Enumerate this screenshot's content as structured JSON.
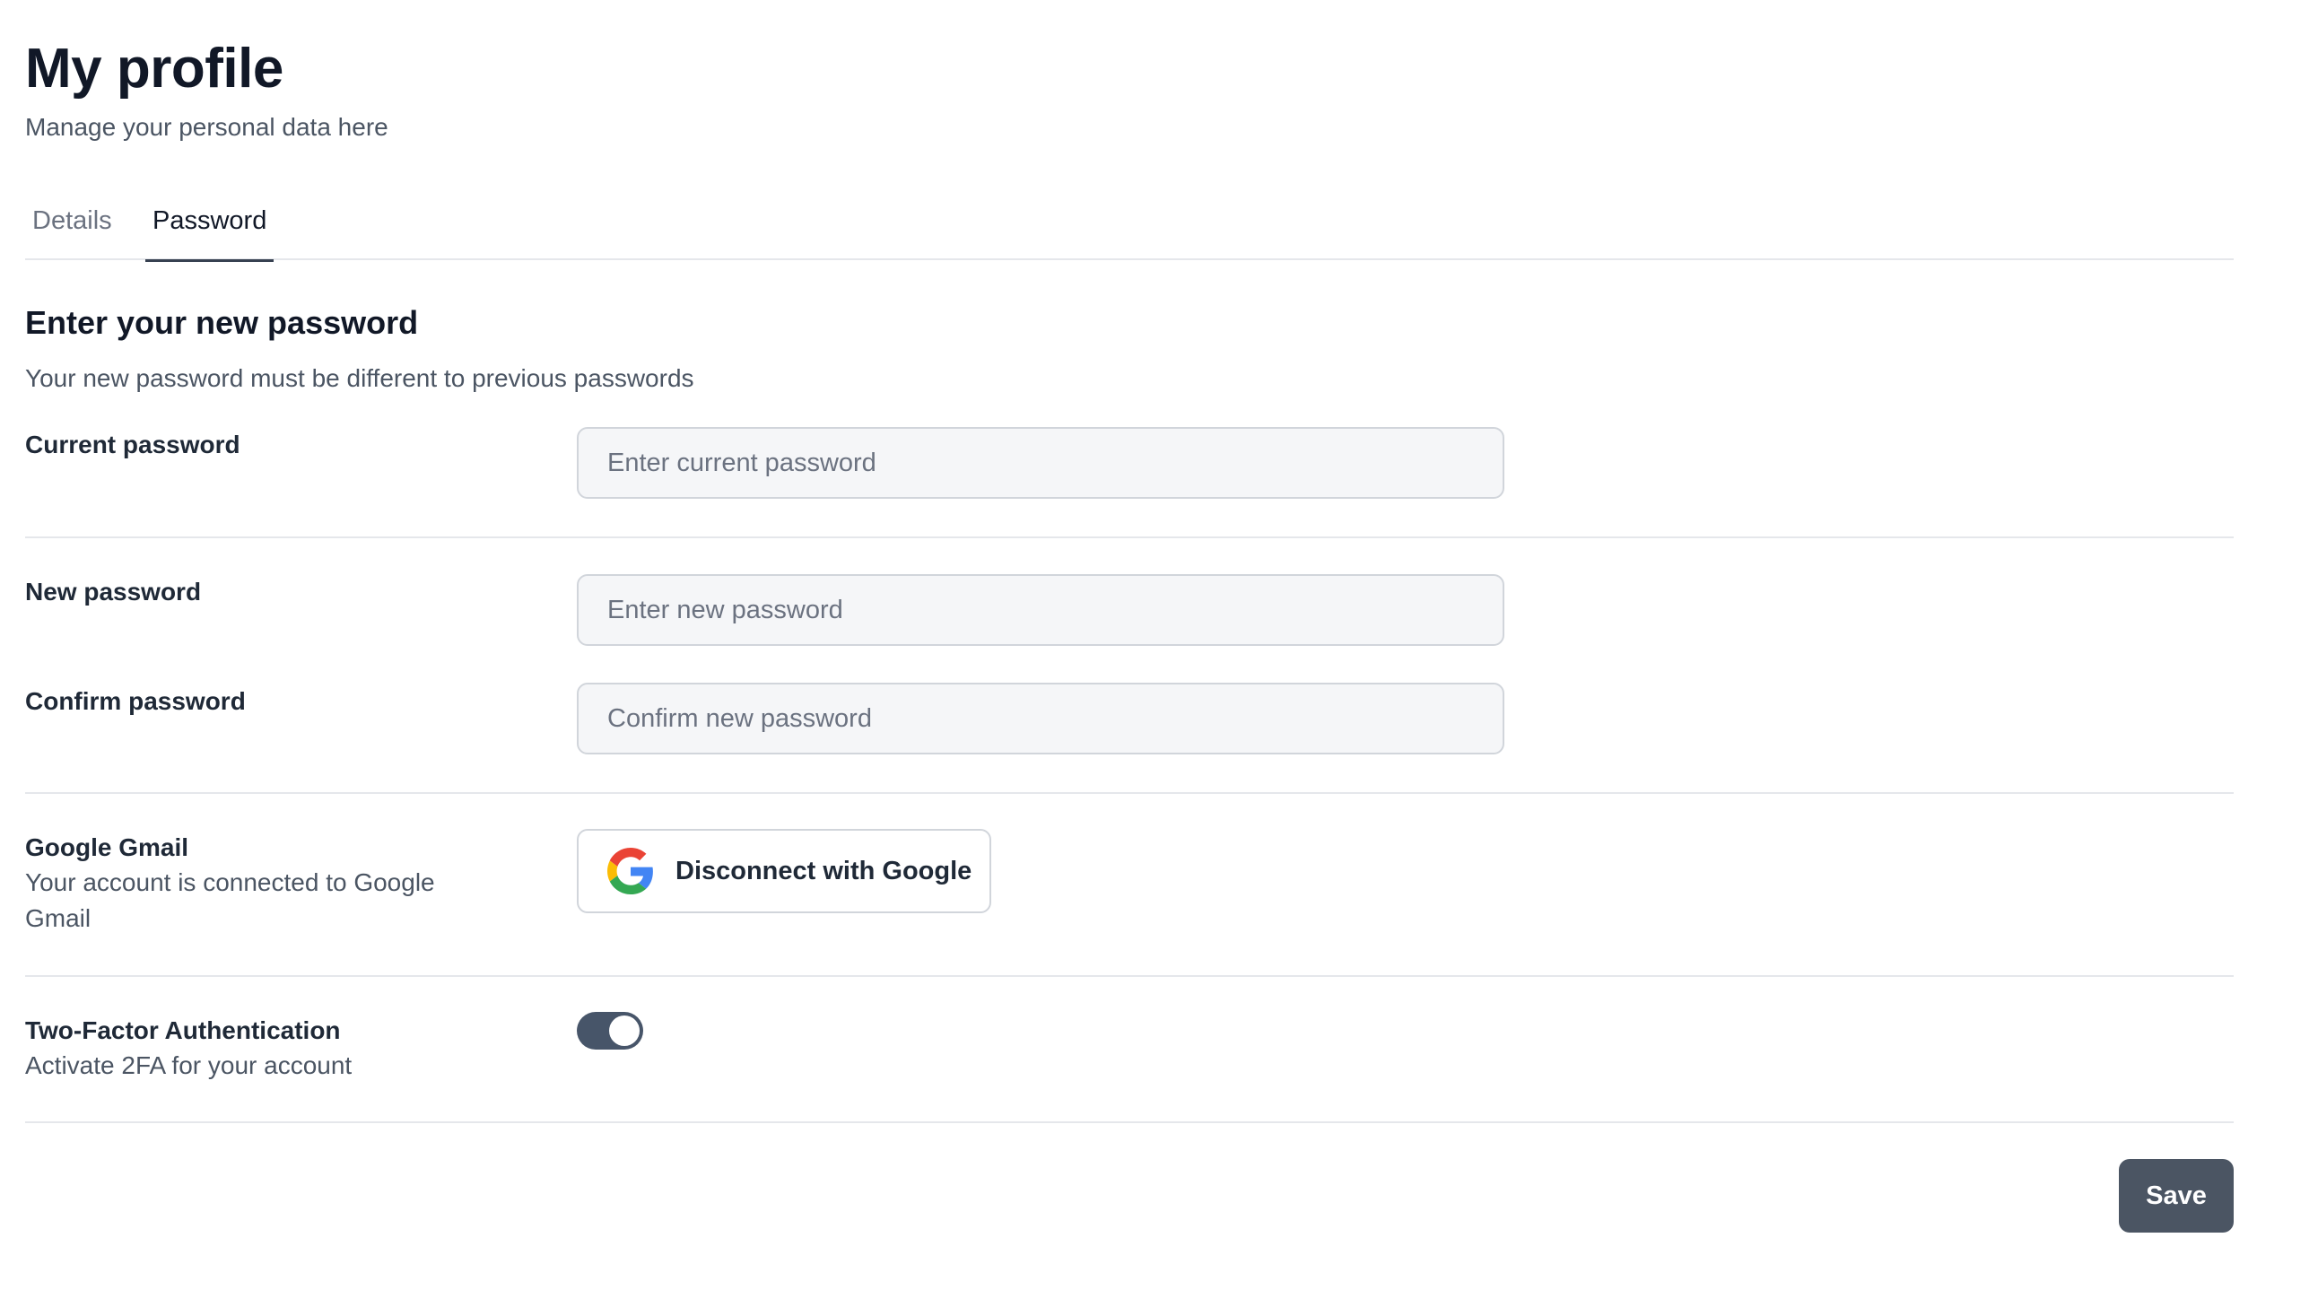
{
  "header": {
    "title": "My profile",
    "subtitle": "Manage your personal data here"
  },
  "tabs": [
    {
      "label": "Details",
      "active": false
    },
    {
      "label": "Password",
      "active": true
    }
  ],
  "section": {
    "title": "Enter your new password",
    "description": "Your new password must be different to previous passwords"
  },
  "fields": {
    "current_password": {
      "label": "Current password",
      "placeholder": "Enter current password",
      "value": ""
    },
    "new_password": {
      "label": "New password",
      "placeholder": "Enter new password",
      "value": ""
    },
    "confirm_password": {
      "label": "Confirm password",
      "placeholder": "Confirm new password",
      "value": ""
    }
  },
  "google": {
    "label": "Google Gmail",
    "help": "Your account is connected to Google Gmail",
    "button_label": "Disconnect with Google",
    "icon": "google-icon"
  },
  "two_factor": {
    "label": "Two-Factor Authentication",
    "help": "Activate 2FA for your account",
    "enabled": true
  },
  "actions": {
    "save_label": "Save"
  },
  "colors": {
    "primary_button": "#4b5563",
    "toggle_on": "#475569",
    "active_tab_underline": "#374151"
  }
}
